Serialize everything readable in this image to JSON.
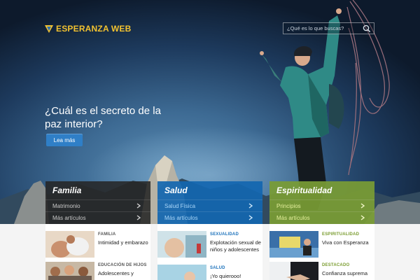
{
  "header": {
    "logo_text": "ESPERANZA WEB",
    "search_placeholder": "¿Qué es lo que buscas?"
  },
  "hero": {
    "headline": "¿Cuál es el secreto de la paz interior?",
    "cta_label": "Lea más"
  },
  "panels": [
    {
      "title": "Familia",
      "items": [
        "Matrimonio",
        "Más artículos"
      ],
      "color": "#262626"
    },
    {
      "title": "Salud",
      "items": [
        "Salud Física",
        "Más artículos"
      ],
      "color": "#1266b0"
    },
    {
      "title": "Espiritualidad",
      "items": [
        "Principios",
        "Más artículos"
      ],
      "color": "#7a9c34"
    }
  ],
  "articles": [
    {
      "category": "FAMILIA",
      "title": "Intimidad y embarazo"
    },
    {
      "category": "EDUCACIÓN DE HIJOS",
      "title": "Adolescentes y"
    },
    {
      "category": "SEXUALIDAD",
      "title": "Explotación sexual de niños y adolescentes"
    },
    {
      "category": "SALUD",
      "title": "¡Yo quierooo!"
    },
    {
      "category": "ESPIRITUALIDAD",
      "title": "Viva con Esperanza"
    },
    {
      "category": "DESTACADO",
      "title": "Confianza suprema"
    }
  ],
  "colors": {
    "logo": "#f2c230",
    "cta": "#2f7fc7",
    "salud": "#1266b0",
    "espiritualidad": "#7a9c34"
  }
}
